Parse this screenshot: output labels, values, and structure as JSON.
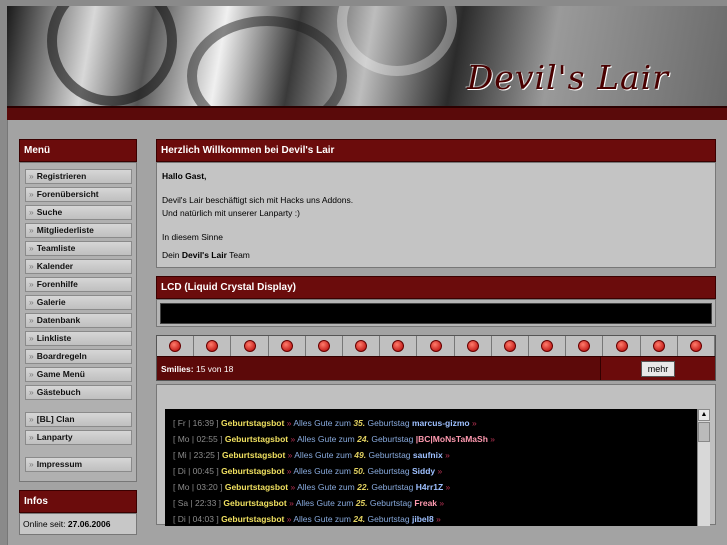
{
  "banner": {
    "logo": "Devil's Lair"
  },
  "sidebar": {
    "menu_title": "Menü",
    "items": [
      "Registrieren",
      "Forenübersicht",
      "Suche",
      "Mitgliederliste",
      "Teamliste",
      "Kalender",
      "Forenhilfe",
      "Galerie",
      "Datenbank",
      "Linkliste",
      "Boardregeln",
      "Game Menü",
      "Gästebuch"
    ],
    "items2": [
      "[BL] Clan",
      "Lanparty"
    ],
    "items3": [
      "Impressum"
    ],
    "infos_title": "Infos",
    "online_label": "Online seit:",
    "online_value": "27.06.2006"
  },
  "welcome": {
    "title": "Herzlich Willkommen bei Devil's Lair",
    "greeting": "Hallo Gast,",
    "line1": "Devil's Lair beschäftigt sich mit Hacks uns Addons.",
    "line2": "Und natürlich mit unserer Lanparty :)",
    "line3": "In diesem Sinne",
    "sig_pre": "Dein",
    "sig_bold": "Devil's Lair",
    "sig_post": "Team"
  },
  "lcd": {
    "title": "LCD (Liquid Crystal Display)"
  },
  "smilies": {
    "count_label": "Smilies:",
    "count_value": "15 von 18",
    "more_button": "mehr",
    "icons": [
      "smiley-1",
      "smiley-2",
      "smiley-3",
      "smiley-4",
      "smiley-5",
      "smiley-6",
      "smiley-7",
      "smiley-8",
      "smiley-9",
      "smiley-10",
      "smiley-11",
      "smiley-12",
      "smiley-13",
      "smiley-14",
      "smiley-15"
    ]
  },
  "chat": {
    "messages": [
      {
        "time": "[ Fr | 16:39 ]",
        "bot": "Geburtstagsbot",
        "pre": "Alles Gute zum",
        "num": "35.",
        "post": "Geburtstag",
        "user": "marcus-gizmo",
        "color": "#9ec0ff"
      },
      {
        "time": "[ Mo | 02:55 ]",
        "bot": "Geburtstagsbot",
        "pre": "Alles Gute zum",
        "num": "24.",
        "post": "Geburtstag",
        "user": "|BC|MoNsTaMaSh",
        "color": "#ff9ab0"
      },
      {
        "time": "[ Mi | 23:25 ]",
        "bot": "Geburtstagsbot",
        "pre": "Alles Gute zum",
        "num": "49.",
        "post": "Geburtstag",
        "user": "saufnix",
        "color": "#9ec0ff"
      },
      {
        "time": "[ Di | 00:45 ]",
        "bot": "Geburtstagsbot",
        "pre": "Alles Gute zum",
        "num": "50.",
        "post": "Geburtstag",
        "user": "Siddy",
        "color": "#9ec0ff"
      },
      {
        "time": "[ Mo | 03:20 ]",
        "bot": "Geburtstagsbot",
        "pre": "Alles Gute zum",
        "num": "22.",
        "post": "Geburtstag",
        "user": "H4rr1Z",
        "color": "#9ec0ff"
      },
      {
        "time": "[ Sa | 22:33 ]",
        "bot": "Geburtstagsbot",
        "pre": "Alles Gute zum",
        "num": "25.",
        "post": "Geburtstag",
        "user": "Freak",
        "color": "#ff9ab0"
      },
      {
        "time": "[ Di | 04:03 ]",
        "bot": "Geburtstagsbot",
        "pre": "Alles Gute zum",
        "num": "24.",
        "post": "Geburtstag",
        "user": "jibel8",
        "color": "#9ec0ff"
      }
    ]
  }
}
